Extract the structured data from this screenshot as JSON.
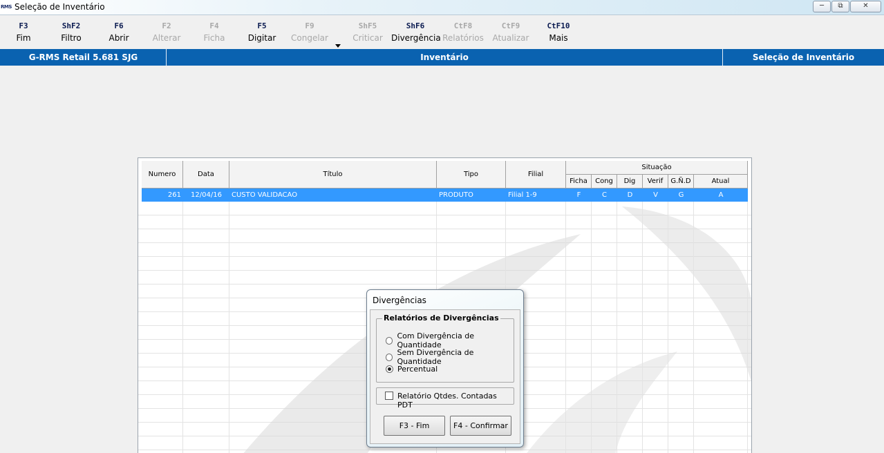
{
  "window": {
    "logo": "RMS",
    "title": "Seleção de Inventário"
  },
  "toolbar": [
    {
      "key": "F3",
      "label": "Fim",
      "enabled": true
    },
    {
      "key": "ShF2",
      "label": "Filtro",
      "enabled": true
    },
    {
      "key": "F6",
      "label": "Abrir",
      "enabled": true
    },
    {
      "key": "F2",
      "label": "Alterar",
      "enabled": false
    },
    {
      "key": "F4",
      "label": "Ficha",
      "enabled": false
    },
    {
      "key": "F5",
      "label": "Digitar",
      "enabled": true
    },
    {
      "key": "F9",
      "label": "Congelar",
      "enabled": false
    },
    {
      "key": "ShF5",
      "label": "Criticar",
      "enabled": false
    },
    {
      "key": "ShF6",
      "label": "Divergência",
      "enabled": true
    },
    {
      "key": "CtF8",
      "label": "Relatórios",
      "enabled": false
    },
    {
      "key": "CtF9",
      "label": "Atualizar",
      "enabled": false
    },
    {
      "key": "CtF10",
      "label": "Mais",
      "enabled": true
    }
  ],
  "header": {
    "app": "G-RMS Retail 5.681 SJG",
    "module": "Inventário",
    "screen": "Seleção de Inventário"
  },
  "grid": {
    "columns": {
      "numero": "Numero",
      "data": "Data",
      "titulo": "Título",
      "tipo": "Tipo",
      "filial": "Filial",
      "situacao": "Situação"
    },
    "situacao_columns": [
      "Ficha",
      "Cong",
      "Dig",
      "Verif",
      "G.Ñ.D",
      "Atual"
    ],
    "rows": [
      {
        "numero": "261",
        "data": "12/04/16",
        "titulo": "CUSTO VALIDACAO",
        "tipo": "PRODUTO",
        "filial": "Filial 1-9",
        "situacao": [
          "F",
          "C",
          "D",
          "V",
          "G",
          "A"
        ]
      }
    ],
    "selected_row_color": "#3399ff"
  },
  "dialog": {
    "title": "Divergências",
    "group_title": "Relatórios de Divergências",
    "options": [
      "Com Divergência de Quantidade",
      "Sem Divergência de Quantidade",
      "Percentual"
    ],
    "selected_option": "Percentual",
    "checkbox_label": "Relatório Qtdes. Contadas PDT",
    "checkbox_checked": false,
    "cancel_label": "F3 - Fim",
    "confirm_label": "F4 - Confirmar"
  }
}
